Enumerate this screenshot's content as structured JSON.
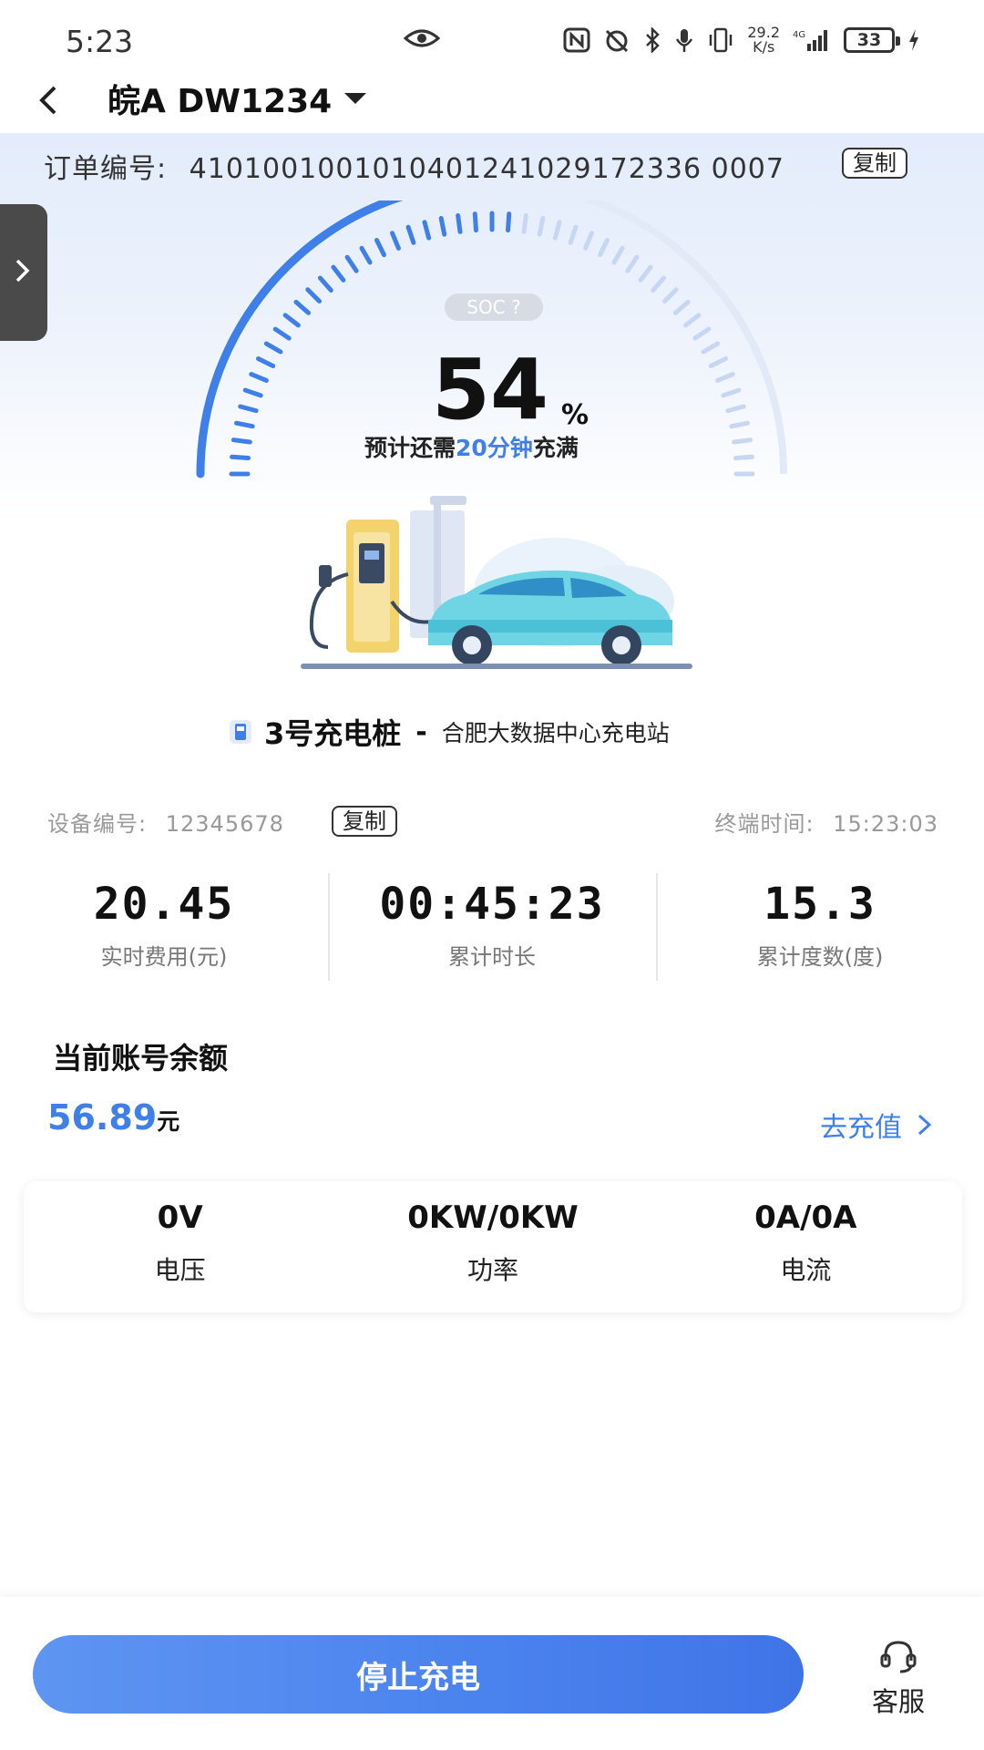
{
  "status_bar": {
    "time": "5:23",
    "net_speed_value": "29.2",
    "net_speed_unit": "K/s",
    "network": "4G",
    "battery": "33"
  },
  "header": {
    "plate": "皖A DW1234"
  },
  "order": {
    "label": "订单编号:",
    "number": "4101001001010401241029172336 0007",
    "copy_label": "复制"
  },
  "gauge": {
    "soc_label": "SOC",
    "soc_percent": 54,
    "value": "54",
    "unit": "%",
    "eta_prefix": "预计还需",
    "eta_highlight": "20分钟",
    "eta_suffix": "充满",
    "accent_color": "#3f7fe8"
  },
  "pile": {
    "name": "3号充电桩",
    "separator": "-",
    "station": "合肥大数据中心充电站"
  },
  "device": {
    "label": "设备编号:",
    "number": "12345678",
    "copy_label": "复制",
    "terminal_label": "终端时间:",
    "terminal_time": "15:23:03"
  },
  "stats": [
    {
      "value": "20.45",
      "label": "实时费用(元)"
    },
    {
      "value": "00:45:23",
      "label": "累计时长"
    },
    {
      "value": "15.3",
      "label": "累计度数(度)"
    }
  ],
  "balance": {
    "title": "当前账号余额",
    "amount": "56.89",
    "unit": "元",
    "recharge_label": "去充值"
  },
  "meters": [
    {
      "value": "0V",
      "label": "电压"
    },
    {
      "value": "0KW/0KW",
      "label": "功率"
    },
    {
      "value": "0A/0A",
      "label": "电流"
    }
  ],
  "footer": {
    "stop_label": "停止充电",
    "service_label": "客服"
  }
}
